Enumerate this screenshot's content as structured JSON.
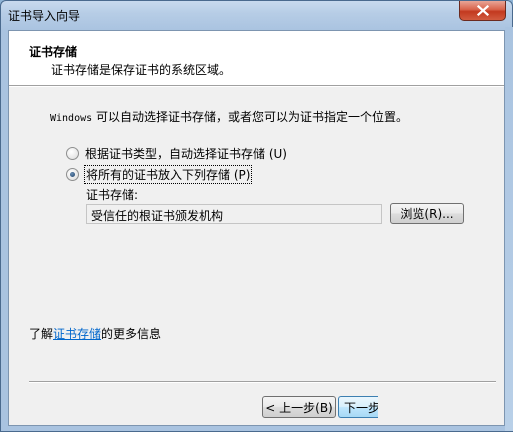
{
  "window": {
    "title": "证书导入向导"
  },
  "header": {
    "title": "证书存储",
    "subtitle": "证书存储是保存证书的系统区域。"
  },
  "description": {
    "mono_part": "Windows",
    "rest": " 可以自动选择证书存储，或者您可以为证书指定一个位置。"
  },
  "options": {
    "auto": {
      "label": "根据证书类型，自动选择证书存储 (U)",
      "checked": false
    },
    "manual": {
      "label": "将所有的证书放入下列存储 (P)",
      "checked": true
    }
  },
  "store": {
    "label": "证书存储:",
    "value": "受信任的根证书颁发机构",
    "browse_label": "浏览(R)..."
  },
  "learn_more": {
    "prefix": "了解",
    "link": "证书存储",
    "suffix": "的更多信息"
  },
  "buttons": {
    "back": "< 上一步(B)",
    "next": "下一步"
  },
  "colors": {
    "link": "#0066cc",
    "close_button": "#c2391f"
  }
}
